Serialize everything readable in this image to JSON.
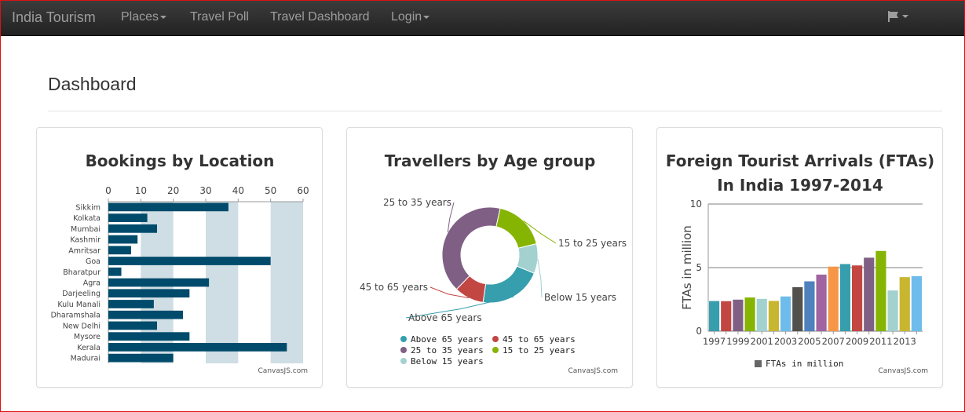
{
  "navbar": {
    "brand": "India Tourism",
    "items": [
      {
        "label": "Places",
        "dropdown": true
      },
      {
        "label": "Travel Poll",
        "dropdown": false
      },
      {
        "label": "Travel Dashboard",
        "dropdown": false
      },
      {
        "label": "Login",
        "dropdown": true
      }
    ],
    "flag_icon": "flag-icon"
  },
  "page": {
    "title": "Dashboard"
  },
  "credit": "CanvasJS.com",
  "chart_data": [
    {
      "type": "bar",
      "title": "Bookings by Location",
      "orientation": "horizontal",
      "categories": [
        "Sikkim",
        "Kolkata",
        "Mumbai",
        "Kashmir",
        "Amritsar",
        "Goa",
        "Bharatpur",
        "Agra",
        "Darjeeling",
        "Kulu Manali",
        "Dharamshala",
        "New Delhi",
        "Mysore",
        "Kerala",
        "Madurai"
      ],
      "values": [
        37,
        12,
        15,
        9,
        7,
        50,
        4,
        31,
        25,
        14,
        23,
        15,
        25,
        55,
        20
      ],
      "xlim": [
        0,
        60
      ],
      "ticks": [
        0,
        10,
        20,
        30,
        40,
        50,
        60
      ],
      "color": "#004b6b",
      "interlaced_bands": true,
      "axis_position": "top"
    },
    {
      "type": "pie",
      "subtype": "doughnut",
      "title": "Travellers by Age group",
      "slices": [
        {
          "label": "Above 65 years",
          "value": 19,
          "color": "#369ead"
        },
        {
          "label": "45 to 65 years",
          "value": 9,
          "color": "#c24642"
        },
        {
          "label": "25 to 35 years",
          "value": 37,
          "color": "#7f6084"
        },
        {
          "label": "15 to 25 years",
          "value": 16,
          "color": "#86b402"
        },
        {
          "label": "Below 15 years",
          "value": 9,
          "color": "#a2d1cf"
        }
      ],
      "legend": "bottom"
    },
    {
      "type": "bar",
      "title": [
        "Foreign Tourist Arrivals (FTAs)",
        "In India 1997-2014"
      ],
      "ylabel": "FTAs in million",
      "ylim": [
        0,
        10
      ],
      "yticks": [
        0,
        5,
        10
      ],
      "xtick_labels": [
        "1997",
        "1999",
        "2001",
        "2003",
        "2005",
        "2007",
        "2009",
        "2011",
        "2013"
      ],
      "series": [
        {
          "name": "FTAs in million",
          "legend_color": "#666666"
        }
      ],
      "bars": [
        {
          "year": 1997,
          "value": 2.37,
          "color": "#369ead"
        },
        {
          "year": 1998,
          "value": 2.36,
          "color": "#c24642"
        },
        {
          "year": 1999,
          "value": 2.48,
          "color": "#7f6084"
        },
        {
          "year": 2000,
          "value": 2.65,
          "color": "#86b402"
        },
        {
          "year": 2001,
          "value": 2.54,
          "color": "#a2d1cf"
        },
        {
          "year": 2002,
          "value": 2.38,
          "color": "#c8b631"
        },
        {
          "year": 2003,
          "value": 2.73,
          "color": "#6dbceb"
        },
        {
          "year": 2004,
          "value": 3.46,
          "color": "#52514e"
        },
        {
          "year": 2005,
          "value": 3.92,
          "color": "#4f81bc"
        },
        {
          "year": 2006,
          "value": 4.45,
          "color": "#a064a1"
        },
        {
          "year": 2007,
          "value": 5.08,
          "color": "#f79647"
        },
        {
          "year": 2008,
          "value": 5.28,
          "color": "#369ead"
        },
        {
          "year": 2009,
          "value": 5.17,
          "color": "#c24642"
        },
        {
          "year": 2010,
          "value": 5.78,
          "color": "#7f6084"
        },
        {
          "year": 2011,
          "value": 6.31,
          "color": "#86b402"
        },
        {
          "year": 2012,
          "value": 3.2,
          "color": "#a2d1cf"
        },
        {
          "year": 2013,
          "value": 4.25,
          "color": "#c8b631"
        },
        {
          "year": 2014,
          "value": 4.33,
          "color": "#6dbceb"
        }
      ],
      "legend": "bottom"
    }
  ]
}
